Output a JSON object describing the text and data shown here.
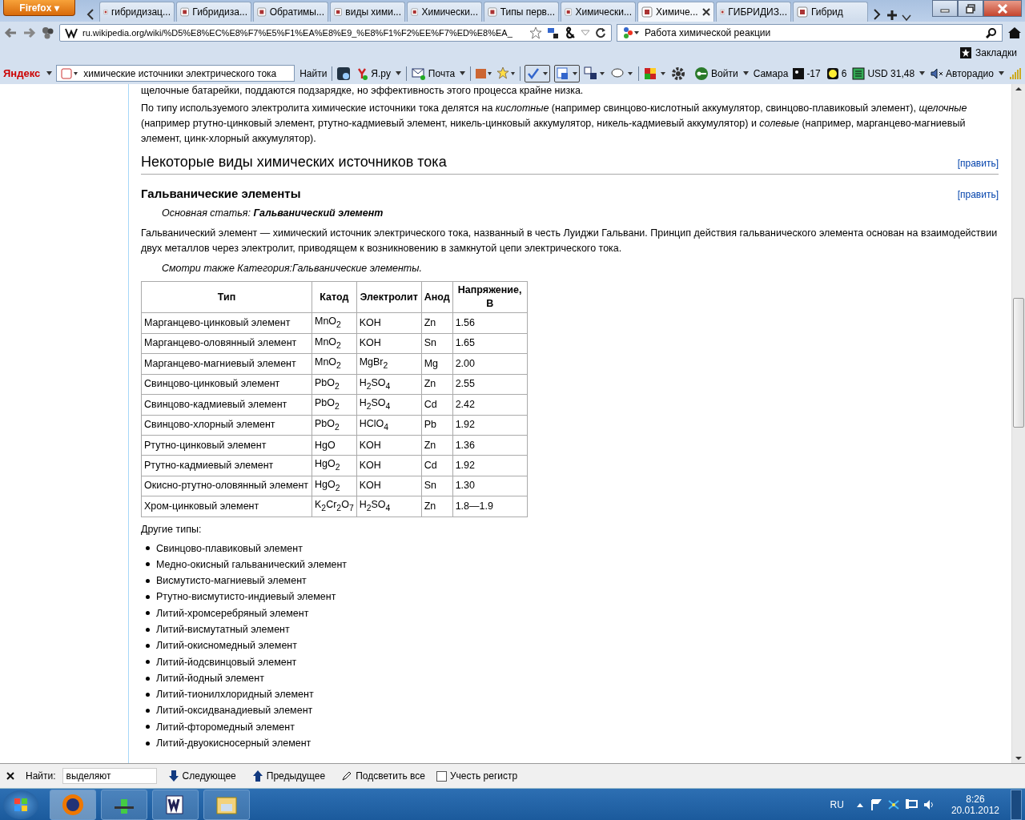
{
  "firefox_button": {
    "label": "Firefox ▾"
  },
  "tabs": [
    {
      "label": "гибридизац...",
      "selected": false
    },
    {
      "label": "Гибридиза...",
      "selected": false
    },
    {
      "label": "Обратимы...",
      "selected": false
    },
    {
      "label": "виды хими...",
      "selected": false
    },
    {
      "label": "Химически...",
      "selected": false
    },
    {
      "label": "Типы перв...",
      "selected": false
    },
    {
      "label": "Химически...",
      "selected": false
    },
    {
      "label": "Химиче...",
      "selected": true
    },
    {
      "label": "ГИБРИДИЗ...",
      "selected": false
    },
    {
      "label": "Гибрид",
      "selected": false
    }
  ],
  "address_bar": {
    "value": "ru.wikipedia.org/wiki/%D5%E8%EC%E8%F7%E5%F1%EA%E8%E9_%E8%F1%F2%EE%F7%ED%E8%EA_"
  },
  "search_bar": {
    "value": "Работа химической реакции"
  },
  "bookmarks_button": {
    "label": "Закладки"
  },
  "yandex_bar": {
    "brand": "Яндекс",
    "search_value": "химические источники электрического тока",
    "find_label": "Найти",
    "yaru": "Я.ру",
    "mail": "Почта",
    "login": "Войти",
    "city": "Самара",
    "temperature": "-17",
    "traffic": "6",
    "currency": "USD 31,48",
    "radio": "Авторадио"
  },
  "article": {
    "cut_line": "щелочные батарейки, поддаются подзарядке, но эффективность этого процесса крайне низка.",
    "intro": "По типу используемого электролита химические источники тока делятся на *кислотные* (например свинцово-кислотный аккумулятор, свинцово-плавиковый элемент), *щелочные* (например ртутно-цинковый элемент, ртутно-кадмиевый элемент, никель-цинковый аккумулятор, никель-кадмиевый аккумулятор) и *солевые* (например, марганцево-магниевый элемент, цинк-хлорный аккумулятор).",
    "section_title": "Некоторые виды химических источников тока",
    "section_edit": "[править]",
    "subsection_title": "Гальванические элементы",
    "subsection_edit": "[править]",
    "main_article": "Основная статья: **Гальванический элемент**",
    "paragraph": "Гальванический элемент — химический источник электрического тока, названный в честь Луиджи Гальвани. Принцип действия гальванического элемента основан на взаимодействии двух металлов через электролит, приводящем к возникновению в замкнутой цепи электрического тока.",
    "see_also": "Смотри также Категория:Гальванические элементы.",
    "table": {
      "columns": [
        "Тип",
        "Катод",
        "Электролит",
        "Анод",
        "Напряжение, В"
      ],
      "rows": [
        [
          "Марганцево-цинковый элемент",
          "MnO$_{2}$",
          "KOH",
          "Zn",
          "1.56"
        ],
        [
          "Марганцево-оловянный элемент",
          "MnO$_{2}$",
          "KOH",
          "Sn",
          "1.65"
        ],
        [
          "Марганцево-магниевый элемент",
          "MnO$_{2}$",
          "MgBr$_{2}$",
          "Mg",
          "2.00"
        ],
        [
          "Свинцово-цинковый элемент",
          "PbO$_{2}$",
          "H$_{2}$SO$_{4}$",
          "Zn",
          "2.55"
        ],
        [
          "Свинцово-кадмиевый элемент",
          "PbO$_{2}$",
          "H$_{2}$SO$_{4}$",
          "Cd",
          "2.42"
        ],
        [
          "Свинцово-хлорный элемент",
          "PbO$_{2}$",
          "HClO$_{4}$",
          "Pb",
          "1.92"
        ],
        [
          "Ртутно-цинковый элемент",
          "HgO",
          "KOH",
          "Zn",
          "1.36"
        ],
        [
          "Ртутно-кадмиевый элемент",
          "HgO$_{2}$",
          "KOH",
          "Cd",
          "1.92"
        ],
        [
          "Окисно-ртутно-оловянный элемент",
          "HgO$_{2}$",
          "KOH",
          "Sn",
          "1.30"
        ],
        [
          "Хром-цинковый элемент",
          "K$_{2}$Cr$_{2}$O$_{7}$",
          "H$_{2}$SO$_{4}$",
          "Zn",
          "1.8—1.9"
        ]
      ]
    },
    "other_types_label": "Другие типы:",
    "other_types": [
      "Свинцово-плавиковый элемент",
      "Медно-окисный гальванический элемент",
      "Висмутисто-магниевый элемент",
      "Ртутно-висмутисто-индиевый элемент",
      "Литий-хромсеребряный элемент",
      "Литий-висмутатный элемент",
      "Литий-окисномедный элемент",
      "Литий-йодсвинцовый элемент",
      "Литий-йодный элемент",
      "Литий-тионилхлоридный элемент",
      "Литий-оксидванадиевый элемент",
      "Литий-фторомедный элемент",
      "Литий-двуокисносерный элемент"
    ]
  },
  "find_bar": {
    "label": "Найти:",
    "value": "выделяют",
    "next": "Следующее",
    "previous": "Предыдущее",
    "highlight": "Подсветить все",
    "match_case": {
      "label": "Учесть регистр",
      "checked": false
    }
  },
  "taskbar": {
    "language": "RU",
    "time": "8:26",
    "date": "20.01.2012"
  }
}
